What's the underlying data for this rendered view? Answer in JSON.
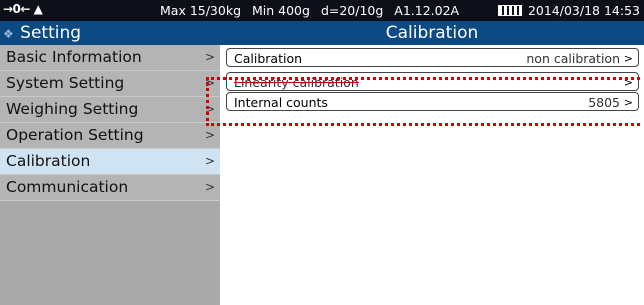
{
  "status_bar": {
    "zero_icon": "→0←",
    "level_icon": "▲",
    "max": "Max 15/30kg",
    "min": "Min 400g",
    "division": "d=20/10g",
    "version": "A1.12.02A",
    "battery_icon": "battery-icon",
    "datetime": "2014/03/18  14:53"
  },
  "sidebar": {
    "title_icon": "❖",
    "title": "Setting",
    "items": [
      {
        "label": "Basic Information"
      },
      {
        "label": "System Setting"
      },
      {
        "label": "Weighing Setting"
      },
      {
        "label": "Operation Setting"
      },
      {
        "label": "Calibration"
      },
      {
        "label": "Communication"
      }
    ],
    "chevron": ">"
  },
  "main": {
    "title": "Calibration",
    "rows": [
      {
        "label": "Calibration",
        "value": "non calibration"
      },
      {
        "label": "Linearity calibration",
        "value": ""
      },
      {
        "label": "Internal counts",
        "value": "5805"
      }
    ],
    "chevron": ">"
  },
  "colors": {
    "header_bg": "#0c4a83",
    "status_bg": "#0d1018",
    "sidebar_bg": "#b4b4b4",
    "active_item_bg": "#cfe3f3",
    "highlight": "#d40000"
  }
}
